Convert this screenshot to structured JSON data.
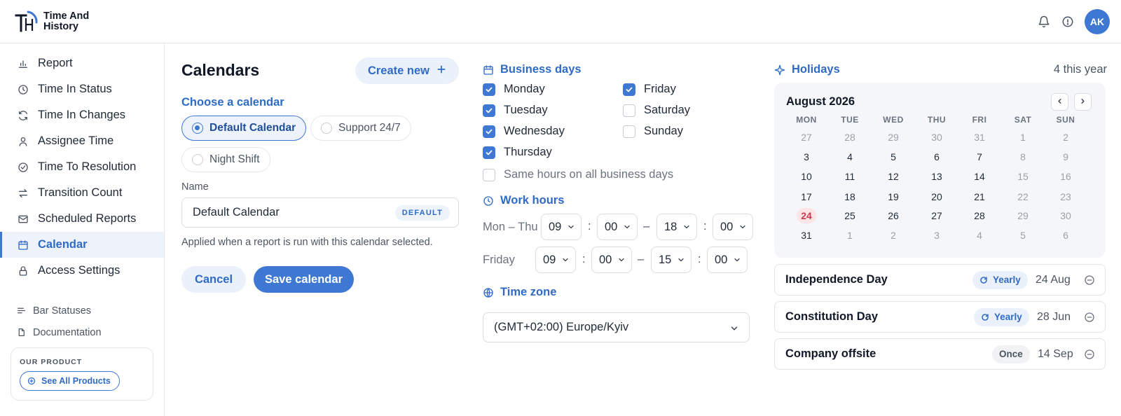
{
  "app": {
    "name_line1": "Time And",
    "name_line2": "History",
    "logo_mark": "TH",
    "user_initials": "AK"
  },
  "header": {
    "icons": [
      "bell-icon",
      "info-icon"
    ]
  },
  "sidebar": {
    "items": [
      {
        "label": "Report",
        "icon": "bar-chart-icon"
      },
      {
        "label": "Time In Status",
        "icon": "clock-icon"
      },
      {
        "label": "Time In Changes",
        "icon": "refresh-icon"
      },
      {
        "label": "Assignee Time",
        "icon": "user-icon"
      },
      {
        "label": "Time To Resolution",
        "icon": "check-circle-icon"
      },
      {
        "label": "Transition Count",
        "icon": "arrows-icon"
      },
      {
        "label": "Scheduled Reports",
        "icon": "mail-icon"
      },
      {
        "label": "Calendar",
        "icon": "calendar-icon",
        "active": true
      },
      {
        "label": "Access Settings",
        "icon": "lock-icon"
      }
    ],
    "secondary": [
      {
        "label": "Bar Statuses",
        "icon": "lines-icon"
      },
      {
        "label": "Documentation",
        "icon": "document-icon"
      }
    ],
    "product": {
      "title": "OUR PRODUCT",
      "button": "See All Products"
    }
  },
  "calendars": {
    "title": "Calendars",
    "create_label": "Create new",
    "choose_label": "Choose a calendar",
    "options": [
      {
        "label": "Default Calendar",
        "selected": true
      },
      {
        "label": "Support 24/7",
        "selected": false
      },
      {
        "label": "Night Shift",
        "selected": false
      }
    ],
    "name_label": "Name",
    "name_value": "Default Calendar",
    "default_badge": "DEFAULT",
    "helper": "Applied when a report is run with this calendar selected.",
    "cancel_label": "Cancel",
    "save_label": "Save calendar"
  },
  "business": {
    "title": "Business days",
    "days": [
      {
        "label": "Monday",
        "checked": true
      },
      {
        "label": "Tuesday",
        "checked": true
      },
      {
        "label": "Wednesday",
        "checked": true
      },
      {
        "label": "Thursday",
        "checked": true
      },
      {
        "label": "Friday",
        "checked": true
      },
      {
        "label": "Saturday",
        "checked": false
      },
      {
        "label": "Sunday",
        "checked": false
      }
    ],
    "same_hours_label": "Same hours on all business days",
    "same_hours_checked": false,
    "work_hours_title": "Work hours",
    "work_hours": [
      {
        "label": "Mon – Thu",
        "start_h": "09",
        "start_m": "00",
        "end_h": "18",
        "end_m": "00"
      },
      {
        "label": "Friday",
        "start_h": "09",
        "start_m": "00",
        "end_h": "15",
        "end_m": "00"
      }
    ],
    "colon": ":",
    "dash": "–",
    "timezone_title": "Time zone",
    "timezone_value": "(GMT+02:00) Europe/Kyiv"
  },
  "holidays": {
    "title": "Holidays",
    "count": "4 this year",
    "month": "August 2026",
    "weekdays": [
      "MON",
      "TUE",
      "WED",
      "THU",
      "FRI",
      "SAT",
      "SUN"
    ],
    "weeks": [
      [
        "27",
        "28",
        "29",
        "30",
        "31",
        "1",
        "2"
      ],
      [
        "3",
        "4",
        "5",
        "6",
        "7",
        "8",
        "9"
      ],
      [
        "10",
        "11",
        "12",
        "13",
        "14",
        "15",
        "16"
      ],
      [
        "17",
        "18",
        "19",
        "20",
        "21",
        "22",
        "23"
      ],
      [
        "24",
        "25",
        "26",
        "27",
        "28",
        "29",
        "30"
      ],
      [
        "31",
        "1",
        "2",
        "3",
        "4",
        "5",
        "6"
      ]
    ],
    "highlight": "24",
    "list": [
      {
        "name": "Independence Day",
        "repeat": "Yearly",
        "date": "24 Aug"
      },
      {
        "name": "Constitution Day",
        "repeat": "Yearly",
        "date": "28 Jun"
      },
      {
        "name": "Company offsite",
        "repeat": "Once",
        "date": "14 Sep"
      }
    ]
  },
  "colors": {
    "accent": "#3e78d2",
    "accent_soft": "#eaf1fb",
    "holiday": "#c53c4e"
  }
}
